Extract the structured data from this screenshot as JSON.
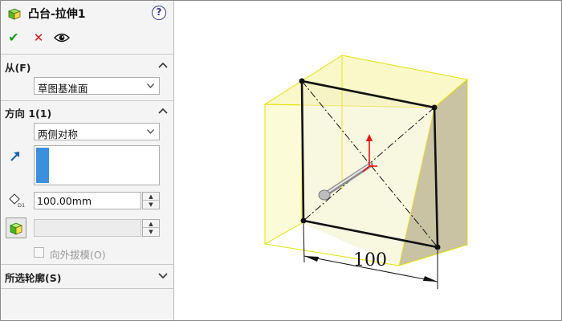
{
  "feature": {
    "title": "凸台-拉伸1",
    "icon": "boss-extrude-icon",
    "help_label": "?"
  },
  "actions": {
    "ok": "✔",
    "cancel": "✕",
    "preview": "eye-icon"
  },
  "from_group": {
    "label": "从(F)",
    "start_condition": "草图基准面"
  },
  "direction1_group": {
    "label": "方向 1(1)",
    "end_condition": "两侧对称",
    "depth_value": "100.00mm",
    "draft_value": "",
    "draft_outward_label": "向外拔模(O)",
    "draft_outward_checked": false
  },
  "selected_contours_group": {
    "label": "所选轮廓(S)"
  },
  "viewport": {
    "dimension_label": "100"
  },
  "colors": {
    "accent_green": "#1e9a1e",
    "cancel_red": "#d11111",
    "selection_blue": "#3b8fdc",
    "preview_yellow": "#f2ef6a",
    "preview_edge": "#e4e000",
    "side_face": "#c9c3a3"
  }
}
